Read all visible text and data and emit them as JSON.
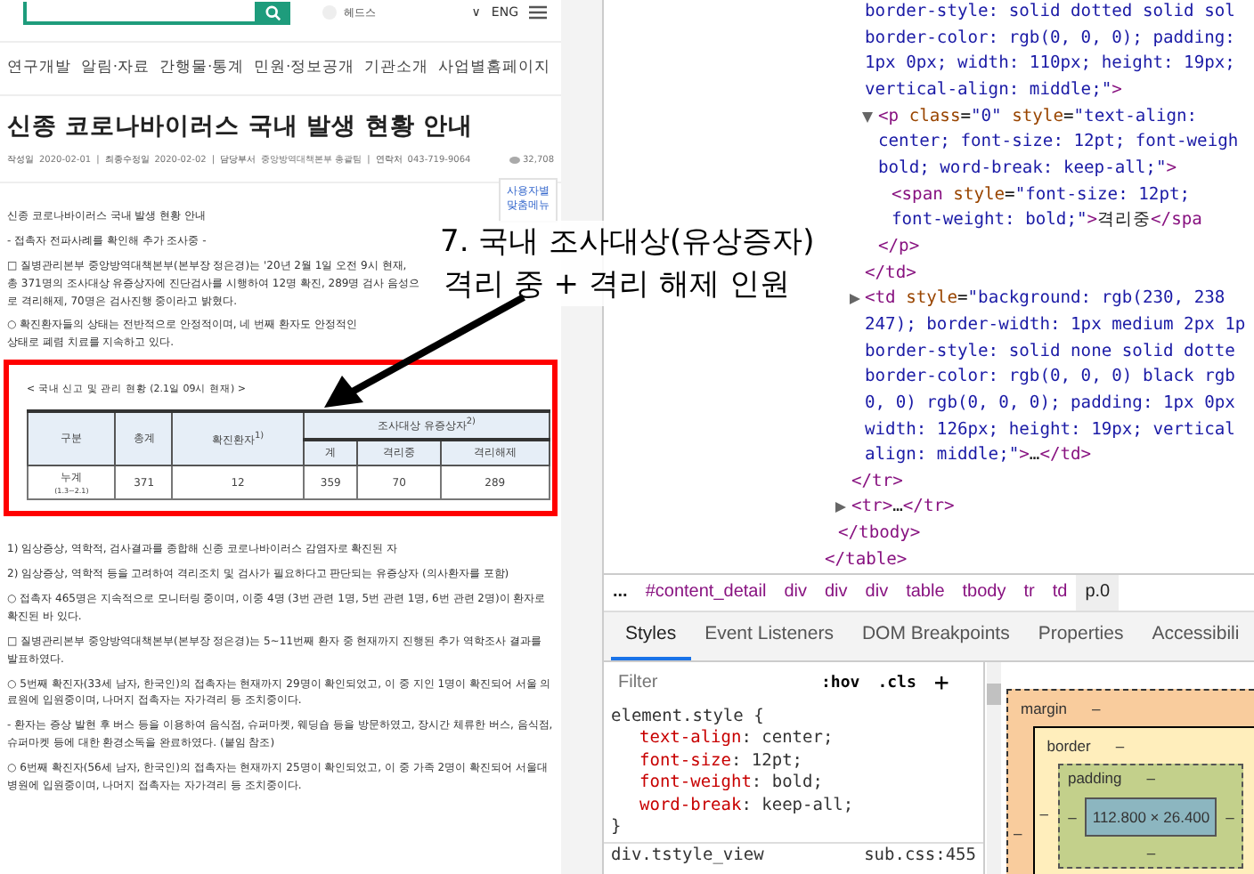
{
  "site": {
    "header": {
      "family_site": "헤드스",
      "caret": "∨",
      "language": "ENG"
    },
    "nav": [
      "연구개발",
      "알림·자료",
      "간행물·통계",
      "민원·정보공개",
      "기관소개",
      "사업별홈페이지"
    ],
    "title": "신종 코로나바이러스 국내 발생 현황 안내",
    "meta": [
      {
        "label": "작성일",
        "value": "2020-02-01"
      },
      {
        "separator": "|",
        "label": "최종수정일",
        "value": "2020-02-02"
      },
      {
        "separator": "|",
        "label": "담당부서",
        "value": "중앙방역대책본부 총괄팀"
      },
      {
        "separator": "|",
        "label": "연락처",
        "value": "043-719-9064"
      }
    ],
    "views": "32,708",
    "side_menu": "사용자별 맞춤메뉴",
    "intro": [
      "신종 코로나바이러스 국내 발생 현황 안내",
      "- 접촉자 전파사례를 확인해 추가 조사중 -",
      "□ 질병관리본부 중앙방역대책본부(본부장 정은경)는 '20년 2월 1일 오전 9시 현재, 총 371명의 조사대상 유증상자에 진단검사를 시행하여 12명 확진, 289명 검사 음성으로 격리해제, 70명은 검사진행 중이라고 밝혔다.",
      "○ 확진환자들의 상태는 전반적으로 안정적이며, 네 번째 환자도 안정적인 상태로 폐렴 치료를 지속하고 있다."
    ],
    "highlight": {
      "caption": "< 국내 신고 및 관리 현황 (2.1일 09시 현재) >",
      "columns": [
        {
          "text": "구분"
        },
        {
          "text": "총계"
        },
        {
          "text": "확진환자$^{1)}$"
        },
        {
          "text": "조사대상 유증상자$^{2)}$",
          "sub": [
            "계",
            "격리중",
            "격리해제"
          ]
        }
      ],
      "rows": [
        {
          "label": "누계",
          "sublabel": "(1.3~2.1)",
          "values": [
            "371",
            "12",
            "359",
            "70",
            "289"
          ]
        }
      ]
    },
    "paragraphs": [
      "1) 임상증상, 역학적, 검사결과를 종합해 신종 코로나바이러스 감염자로 확진된 자",
      "2) 임상증상, 역학적 등을 고려하여 격리조치 및 검사가 필요하다고 판단되는 유증상자 (의사환자를 포함)",
      "○ 접촉자 465명은 지속적으로 모니터링 중이며, 이중 4명 (3번 관련 1명, 5번 관련 1명, 6번 관련 2명)이 환자로 확진된 바 있다.",
      "□ 질병관리본부 중앙방역대책본부(본부장 정은경)는 5~11번째 환자 중 현재까지 진행된 추가 역학조사 결과를 발표하였다.",
      "○ 5번째 확진자(33세 남자, 한국인)의 접촉자는 현재까지 29명이 확인되었고, 이 중 지인 1명이 확진되어 서울 의료원에 입원중이며, 나머지 접촉자는 자가격리 등 조치중이다.",
      "- 환자는 증상 발현 후 버스 등을 이용하여 음식점, 슈퍼마켓, 웨딩숍 등을 방문하였고, 장시간 체류한 버스, 음식점, 슈퍼마켓 등에 대한 환경소독을 완료하였다. (붙임 참조)",
      "○ 6번째 확진자(56세 남자, 한국인)의 접촉자는 현재까지 25명이 확인되었고, 이 중 가족 2명이 확진되어 서울대병원에 입원중이며, 나머지 접촉자는 자가격리 등 조치중이다."
    ]
  },
  "callout": {
    "lines": [
      "7. 국내 조사대상(유상증자)",
      "격리 중 + 격리 해제 인원"
    ]
  },
  "devtools": {
    "elements": {
      "children": [
        {
          "close": [
            {
              "kind": "tag",
              "text": "</table>"
            }
          ],
          "children": [
            {
              "close": [
                {
                  "kind": "tag",
                  "text": "</tbody>"
                }
              ],
              "children": [
                {
                  "close": [
                    {
                      "kind": "tag",
                      "text": "</tr>"
                    }
                  ],
                  "children": [
                    {
                      "lines": [
                        [
                          {
                            "kind": "val",
                            "text": "border-style: solid dotted solid sol"
                          }
                        ],
                        [
                          {
                            "kind": "val",
                            "text": "border-color: rgb(0, 0, 0); padding:"
                          }
                        ],
                        [
                          {
                            "kind": "val",
                            "text": "1px 0px; width: 110px; height: 19px;"
                          }
                        ],
                        [
                          {
                            "kind": "val",
                            "text": "vertical-align: middle;\""
                          },
                          {
                            "kind": "tag",
                            "text": ">"
                          }
                        ]
                      ],
                      "close": [
                        {
                          "kind": "tag",
                          "text": "</td>"
                        }
                      ],
                      "children": [
                        {
                          "expanded": true,
                          "lines": [
                            [
                              {
                                "kind": "tag",
                                "text": "<p"
                              },
                              {
                                "kind": "attr",
                                "text": " class"
                              },
                              {
                                "kind": "pun",
                                "text": "="
                              },
                              {
                                "kind": "val",
                                "text": "\"0\""
                              },
                              {
                                "kind": "attr",
                                "text": " style"
                              },
                              {
                                "kind": "pun",
                                "text": "="
                              },
                              {
                                "kind": "val",
                                "text": "\"text-align:"
                              }
                            ],
                            [
                              {
                                "kind": "val",
                                "text": "center; font-size: 12pt; font-weigh"
                              }
                            ],
                            [
                              {
                                "kind": "val",
                                "text": "bold; word-break: keep-all;\""
                              },
                              {
                                "kind": "tag",
                                "text": ">"
                              }
                            ]
                          ],
                          "close": [
                            {
                              "kind": "tag",
                              "text": "</p>"
                            }
                          ],
                          "children": [
                            {
                              "lines": [
                                [
                                  {
                                    "kind": "tag",
                                    "text": "<span"
                                  },
                                  {
                                    "kind": "attr",
                                    "text": " style"
                                  },
                                  {
                                    "kind": "pun",
                                    "text": "="
                                  },
                                  {
                                    "kind": "val",
                                    "text": "\"font-size: 12pt;"
                                  }
                                ],
                                [
                                  {
                                    "kind": "val",
                                    "text": "font-weight: bold;\""
                                  },
                                  {
                                    "kind": "tag",
                                    "text": ">"
                                  },
                                  {
                                    "kind": "txt",
                                    "text": "격리중"
                                  },
                                  {
                                    "kind": "tag",
                                    "text": "</spa"
                                  }
                                ]
                              ]
                            }
                          ]
                        }
                      ]
                    },
                    {
                      "expanded": false,
                      "lines": [
                        [
                          {
                            "kind": "tag",
                            "text": "<td"
                          },
                          {
                            "kind": "attr",
                            "text": " style"
                          },
                          {
                            "kind": "pun",
                            "text": "="
                          },
                          {
                            "kind": "val",
                            "text": "\"background: rgb(230, 238"
                          }
                        ],
                        [
                          {
                            "kind": "val",
                            "text": "247); border-width: 1px medium 2px 1p"
                          }
                        ],
                        [
                          {
                            "kind": "val",
                            "text": "border-style: solid none solid dotte"
                          }
                        ],
                        [
                          {
                            "kind": "val",
                            "text": "border-color: rgb(0, 0, 0) black rgb"
                          }
                        ],
                        [
                          {
                            "kind": "val",
                            "text": "0, 0) rgb(0, 0, 0); padding: 1px 0px"
                          }
                        ],
                        [
                          {
                            "kind": "val",
                            "text": "width: 126px; height: 19px; vertical"
                          }
                        ],
                        [
                          {
                            "kind": "val",
                            "text": "align: middle;\""
                          },
                          {
                            "kind": "tag",
                            "text": ">"
                          },
                          {
                            "kind": "txt",
                            "text": "…"
                          },
                          {
                            "kind": "tag",
                            "text": "</td>"
                          }
                        ]
                      ]
                    }
                  ]
                },
                {
                  "expanded": false,
                  "lines": [
                    [
                      {
                        "kind": "tag",
                        "text": "<tr>"
                      },
                      {
                        "kind": "txt",
                        "text": "…"
                      },
                      {
                        "kind": "tag",
                        "text": "</tr>"
                      }
                    ]
                  ]
                }
              ]
            }
          ]
        }
      ]
    },
    "breadcrumb": [
      {
        "text": "...",
        "selected": false
      },
      {
        "text": "#content_detail",
        "selected": false
      },
      {
        "text": "div",
        "selected": false
      },
      {
        "text": "div",
        "selected": false
      },
      {
        "text": "div",
        "selected": false
      },
      {
        "text": "table",
        "selected": false
      },
      {
        "text": "tbody",
        "selected": false
      },
      {
        "text": "tr",
        "selected": false
      },
      {
        "text": "td",
        "selected": false
      },
      {
        "text": "p.0",
        "selected": true
      }
    ],
    "tabs": [
      {
        "label": "Styles",
        "selected": true
      },
      {
        "label": "Event Listeners",
        "selected": false
      },
      {
        "label": "DOM Breakpoints",
        "selected": false
      },
      {
        "label": "Properties",
        "selected": false
      },
      {
        "label": "Accessibili",
        "selected": false
      }
    ],
    "styles": {
      "filter_placeholder": "Filter",
      "hov": ":hov",
      "cls": ".cls",
      "add": "+",
      "selector": "element.style {",
      "props": [
        {
          "name": "text-align",
          "value": ": center;"
        },
        {
          "name": "font-size",
          "value": ": 12pt;"
        },
        {
          "name": "font-weight",
          "value": ": bold;"
        },
        {
          "name": "word-break",
          "value": ": keep-all;"
        }
      ],
      "close": "}",
      "next_selector": "div.tstyle_view",
      "next_source": "sub.css:455"
    },
    "box_model": {
      "margin": {
        "label": "margin",
        "top": "–",
        "left": "–"
      },
      "border": {
        "label": "border",
        "top": "–",
        "left": "–"
      },
      "padding": {
        "label": "padding",
        "top": "–",
        "left": "–",
        "right": "–",
        "bottom": "–"
      },
      "content": "112.800 × 26.400"
    }
  }
}
